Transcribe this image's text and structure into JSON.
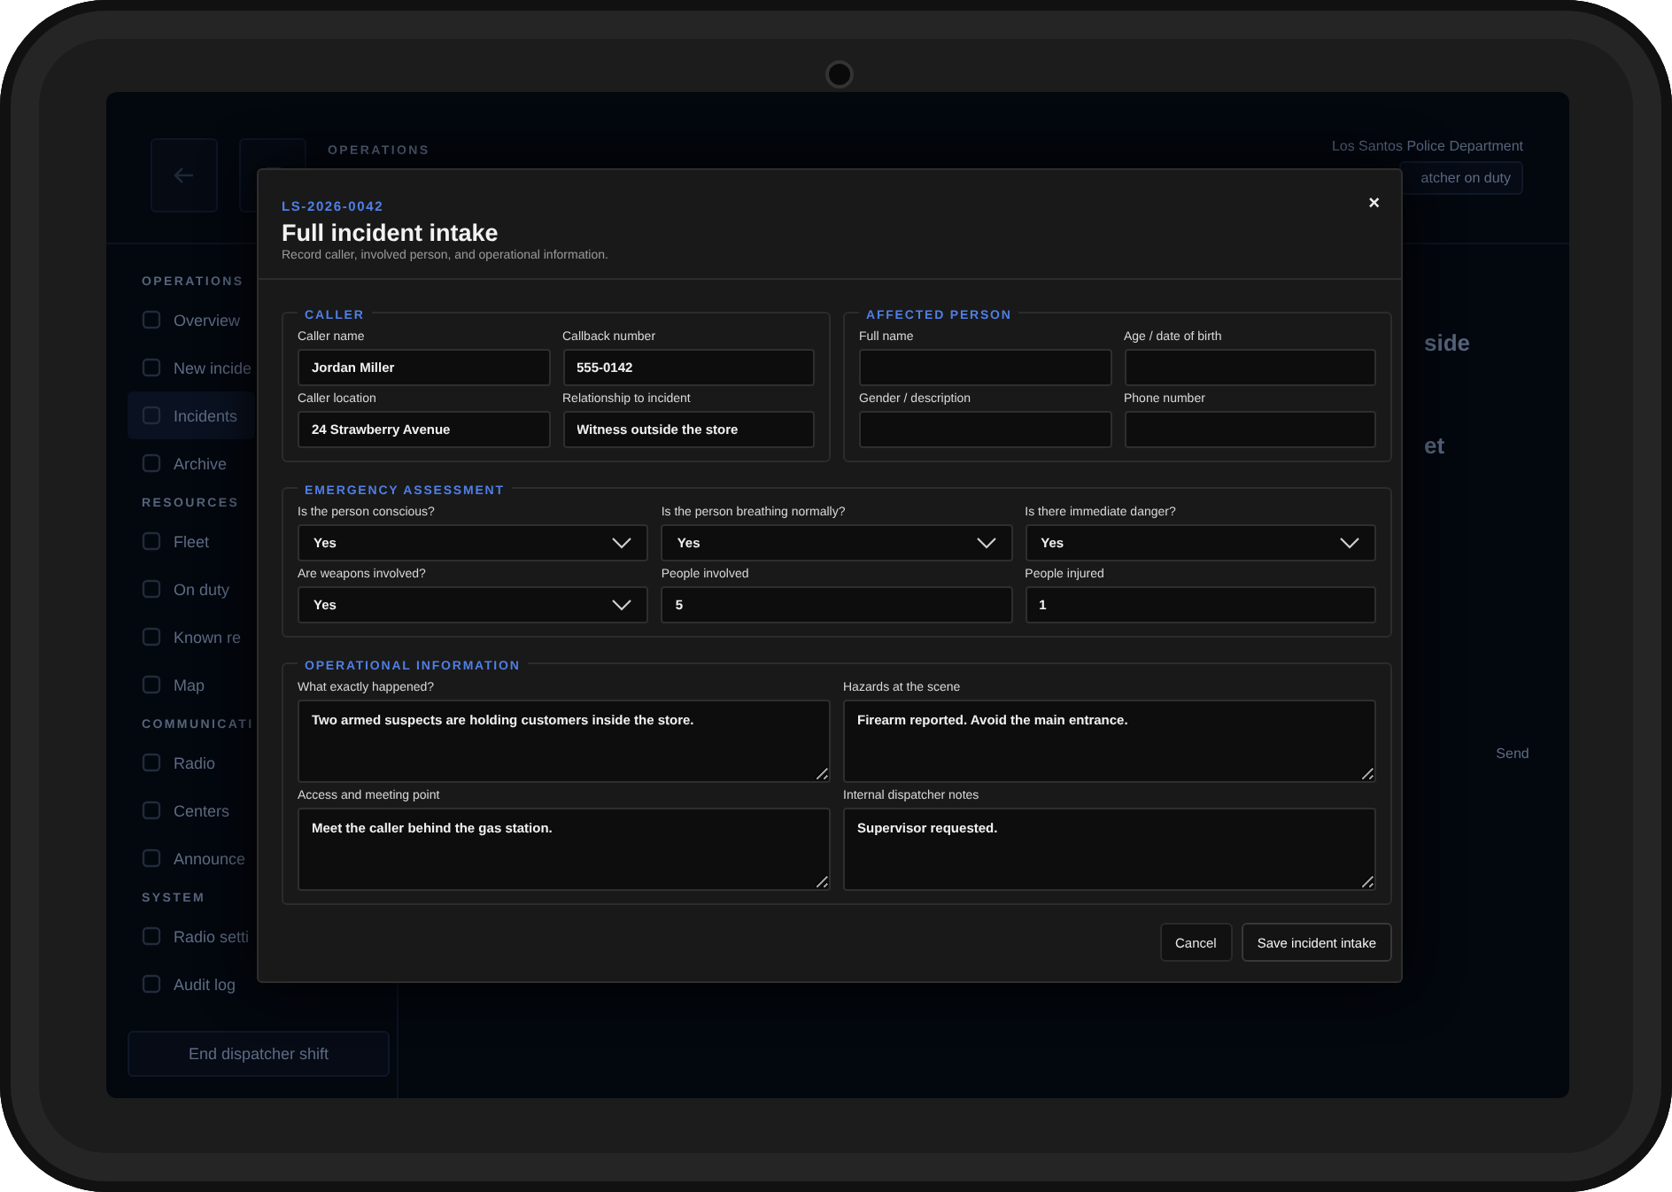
{
  "app": {
    "header": {
      "section_label": "OPERATIONS",
      "organization": "Los Santos Police Department",
      "status_button": "atcher on duty"
    },
    "sidebar": {
      "groups": [
        {
          "title": "OPERATIONS",
          "items": [
            {
              "label": "Overview",
              "selected": false
            },
            {
              "label": "New incide",
              "selected": false
            },
            {
              "label": "Incidents",
              "selected": true
            },
            {
              "label": "Archive",
              "selected": false
            }
          ]
        },
        {
          "title": "RESOURCES",
          "items": [
            {
              "label": "Fleet",
              "selected": false
            },
            {
              "label": "On duty",
              "selected": false
            },
            {
              "label": "Known re",
              "selected": false
            },
            {
              "label": "Map",
              "selected": false
            }
          ]
        },
        {
          "title": "COMMUNICATI",
          "items": [
            {
              "label": "Radio",
              "selected": false
            },
            {
              "label": "Centers",
              "selected": false
            },
            {
              "label": "Announce",
              "selected": false
            }
          ]
        },
        {
          "title": "SYSTEM",
          "items": [
            {
              "label": "Radio setti",
              "selected": false
            },
            {
              "label": "Audit log",
              "selected": false
            }
          ]
        }
      ],
      "end_shift_button": "End dispatcher shift"
    },
    "content_fragments": [
      "side",
      "et"
    ],
    "send_button": "Send"
  },
  "modal": {
    "incident_id": "LS-2026-0042",
    "title": "Full incident intake",
    "subtitle": "Record caller, involved person, and operational information.",
    "close_button": "×",
    "sections": [
      {
        "title": "CALLER",
        "fields": [
          {
            "kind": "text",
            "label": "Caller name",
            "value": "Jordan Miller"
          },
          {
            "kind": "text",
            "label": "Callback number",
            "value": "555-0142"
          },
          {
            "kind": "text",
            "label": "Caller location",
            "value": "24 Strawberry Avenue"
          },
          {
            "kind": "text",
            "label": "Relationship to incident",
            "value": "Witness outside the store"
          }
        ]
      },
      {
        "title": "AFFECTED PERSON",
        "fields": [
          {
            "kind": "text",
            "label": "Full name"
          },
          {
            "kind": "text",
            "label": "Age / date of birth"
          },
          {
            "kind": "text",
            "label": "Gender / description"
          },
          {
            "kind": "text",
            "label": "Phone number"
          }
        ]
      },
      {
        "title": "EMERGENCY ASSESSMENT",
        "fields": [
          {
            "kind": "select",
            "label": "Is the person conscious?",
            "value": "Yes"
          },
          {
            "kind": "select",
            "label": "Is the person breathing normally?",
            "value": "Yes"
          },
          {
            "kind": "select",
            "label": "Is there immediate danger?",
            "value": "Yes"
          },
          {
            "kind": "select",
            "label": "Are weapons involved?",
            "value": "Yes"
          },
          {
            "kind": "text",
            "label": "People involved",
            "value": "5"
          },
          {
            "kind": "text",
            "label": "People injured",
            "value": "1"
          }
        ]
      },
      {
        "title": "OPERATIONAL INFORMATION",
        "fields": [
          {
            "kind": "textarea",
            "label": "What exactly happened?",
            "value": "Two armed suspects are holding customers inside the store."
          },
          {
            "kind": "textarea",
            "label": "Hazards at the scene",
            "value": "Firearm reported. Avoid the main entrance."
          },
          {
            "kind": "textarea",
            "label": "Access and meeting point",
            "value": "Meet the caller behind the gas station."
          },
          {
            "kind": "textarea",
            "label": "Internal dispatcher notes",
            "value": "Supervisor requested."
          }
        ]
      }
    ],
    "buttons": [
      {
        "kind": "secondary",
        "label": "Cancel"
      },
      {
        "kind": "primary",
        "label": "Save incident intake"
      }
    ]
  }
}
